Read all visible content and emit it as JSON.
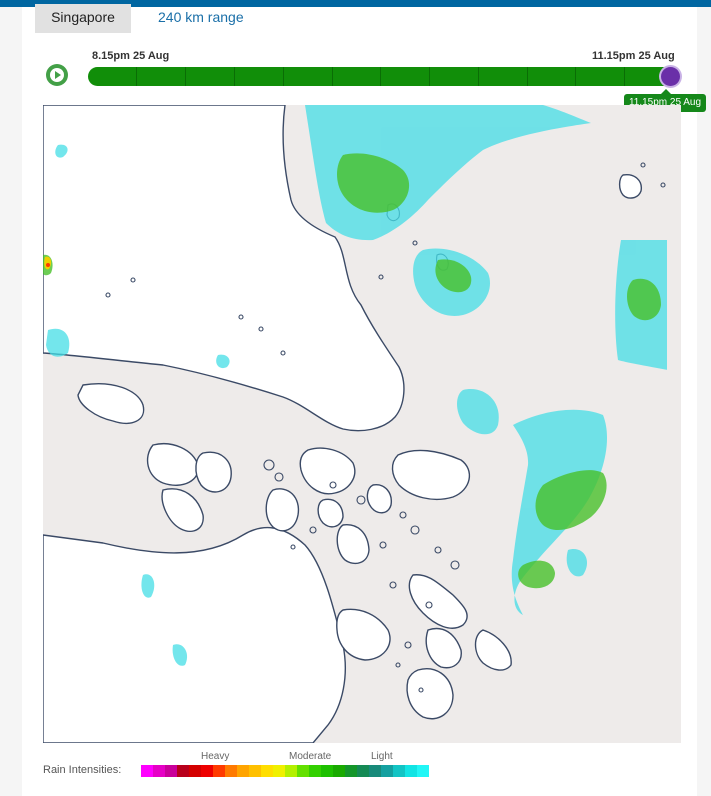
{
  "tabs": {
    "active": "Singapore",
    "link": "240 km range"
  },
  "timeline": {
    "start_label": "8.15pm 25 Aug",
    "end_label": "11.15pm 25 Aug",
    "current_label": "11.15pm 25 Aug",
    "progress": 1.0
  },
  "legend": {
    "title": "Rain Intensities:",
    "heavy": "Heavy",
    "moderate": "Moderate",
    "light": "Light",
    "colors": [
      "#ff00ff",
      "#e600c6",
      "#c9009a",
      "#b8001c",
      "#d40000",
      "#ee0000",
      "#ff3a00",
      "#ff7a00",
      "#ffa400",
      "#ffc000",
      "#ffde00",
      "#f0f000",
      "#b4f000",
      "#64e000",
      "#33d000",
      "#1ec000",
      "#19aa00",
      "#14962a",
      "#158a55",
      "#188a7a",
      "#14a0a0",
      "#12c4c4",
      "#12e4e4",
      "#22f6f6"
    ]
  },
  "colors": {
    "brand": "#0066a1",
    "track": "#118e09",
    "thumb": "#6a2fa8"
  },
  "icons": {
    "play": "play-icon"
  }
}
